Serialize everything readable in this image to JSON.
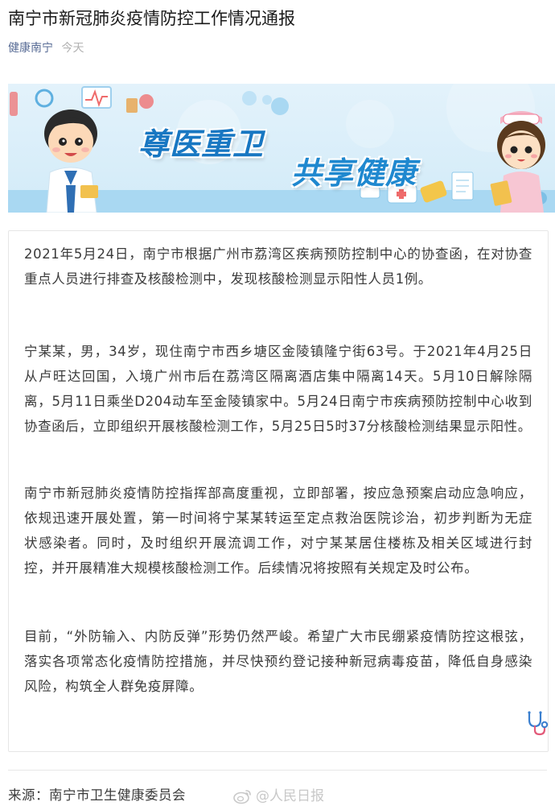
{
  "article": {
    "title": "南宁市新冠肺炎疫情防控工作情况通报",
    "author": "健康南宁",
    "date": "今天"
  },
  "banner": {
    "slogan_1": "尊医重卫",
    "slogan_2": "共享健康"
  },
  "body": {
    "paragraphs": [
      "2021年5月24日，南宁市根据广州市荔湾区疾病预防控制中心的协查函，在对协查重点人员进行排查及核酸检测中，发现核酸检测显示阳性人员1例。",
      "宁某某，男，34岁，现住南宁市西乡塘区金陵镇隆宁街63号。于2021年4月25日从卢旺达回国，入境广州市后在荔湾区隔离酒店集中隔离14天。5月10日解除隔离，5月11日乘坐D204动车至金陵镇家中。5月24日南宁市疾病预防控制中心收到协查函后，立即组织开展核酸检测工作，5月25日5时37分核酸检测结果显示阳性。",
      "南宁市新冠肺炎疫情防控指挥部高度重视，立即部署，按应急预案启动应急响应，依规迅速开展处置，第一时间将宁某某转运至定点救治医院诊治，初步判断为无症状感染者。同时，及时组织开展流调工作，对宁某某居住楼栋及相关区域进行封控，并开展精准大规模核酸检测工作。后续情况将按照有关规定及时公布。",
      "目前，“外防输入、内防反弹”形势仍然严峻。希望广大市民绷紧疫情防控这根弦，落实各项常态化疫情防控措施，并尽快预约登记接种新冠病毒疫苗，降低自身感染风险，构筑全人群免疫屏障。"
    ]
  },
  "footer": {
    "source": "来源：南宁市卫生健康委员会",
    "watermark": "@人民日报"
  },
  "colors": {
    "author_link": "#576b95",
    "slogan_blue": "#1877c2",
    "banner_bg": "#d2ebf8"
  }
}
